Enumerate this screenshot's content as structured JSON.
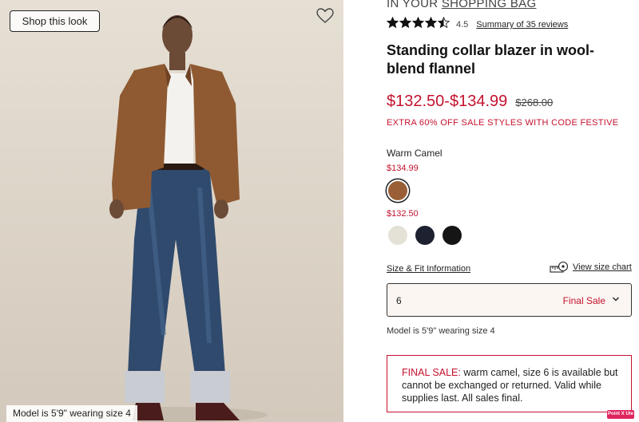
{
  "image": {
    "shop_look_label": "Shop this look",
    "model_caption": "Model is 5'9\" wearing size 4"
  },
  "product": {
    "bag_prefix": "IN YOUR",
    "bag_link": "SHOPPING BAG",
    "rating_value": "4.5",
    "rating_stars": 4.5,
    "reviews_link": "Summary of 35 reviews",
    "title": "Standing collar blazer in wool-blend flannel",
    "price_sale": "$132.50-$134.99",
    "price_original": "$268.00",
    "promo": "EXTRA 60% OFF SALE STYLES WITH CODE FESTIVE",
    "color_name": "Warm Camel",
    "color_groups": [
      {
        "price": "$134.99",
        "swatches": [
          {
            "name": "warm-camel",
            "color": "#9a5f36",
            "selected": true
          }
        ]
      },
      {
        "price": "$132.50",
        "swatches": [
          {
            "name": "ivory",
            "color": "#e4e2d6",
            "selected": false
          },
          {
            "name": "navy",
            "color": "#1d2130",
            "selected": false
          },
          {
            "name": "black",
            "color": "#151515",
            "selected": false
          }
        ]
      }
    ],
    "size_fit_link": "Size & Fit Information",
    "size_chart_link": "View size chart",
    "size_select": {
      "value": "6",
      "status": "Final Sale"
    },
    "model_note": "Model is 5'9\" wearing size 4",
    "final_sale": {
      "label": "FINAL SALE:",
      "text": "warm camel, size 6 is available but cannot be exchanged or returned. Valid while supplies last. All sales final."
    }
  },
  "overlay_badge": "Point X Ute",
  "colors": {
    "sale_red": "#c4122f",
    "select_bg": "#fbf6f2"
  }
}
